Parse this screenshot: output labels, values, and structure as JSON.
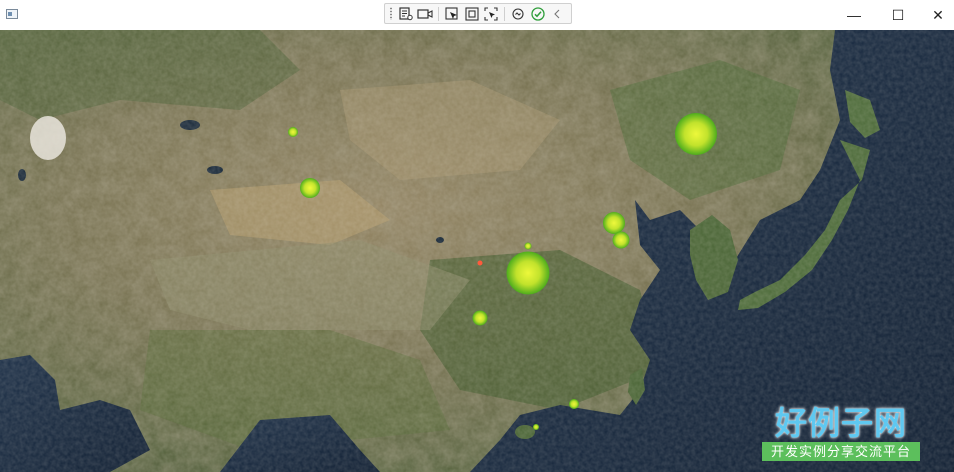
{
  "window": {
    "controls": {
      "minimize_icon": "—",
      "maximize_icon": "☐",
      "close_icon": "✕"
    }
  },
  "dev_toolbar": {
    "icons": [
      "visual-tree-icon",
      "record-icon",
      "select-element-icon",
      "layout-adorner-icon",
      "track-focus-icon",
      "binding-icon",
      "check-icon",
      "collapse-chevron-icon"
    ]
  },
  "map": {
    "bubble_color_center": "#f4ff3a",
    "bubble_color_edge": "#4caf1a",
    "marker_color": "#ff5a3c",
    "points": [
      {
        "name": "point-1",
        "size": 1.0
      },
      {
        "name": "point-2",
        "size": 2.0
      },
      {
        "name": "point-3",
        "size": 4.3
      },
      {
        "name": "point-4",
        "size": 2.2
      },
      {
        "name": "point-5",
        "size": 1.7
      },
      {
        "name": "point-6",
        "size": 0.7
      },
      {
        "name": "point-7",
        "size": 4.2
      },
      {
        "name": "point-8",
        "size": 1.5
      },
      {
        "name": "point-9",
        "size": 1.0
      },
      {
        "name": "point-10",
        "size": 0.6
      }
    ]
  },
  "watermark": {
    "title": "好例子网",
    "subtitle": "开发实例分享交流平台"
  }
}
